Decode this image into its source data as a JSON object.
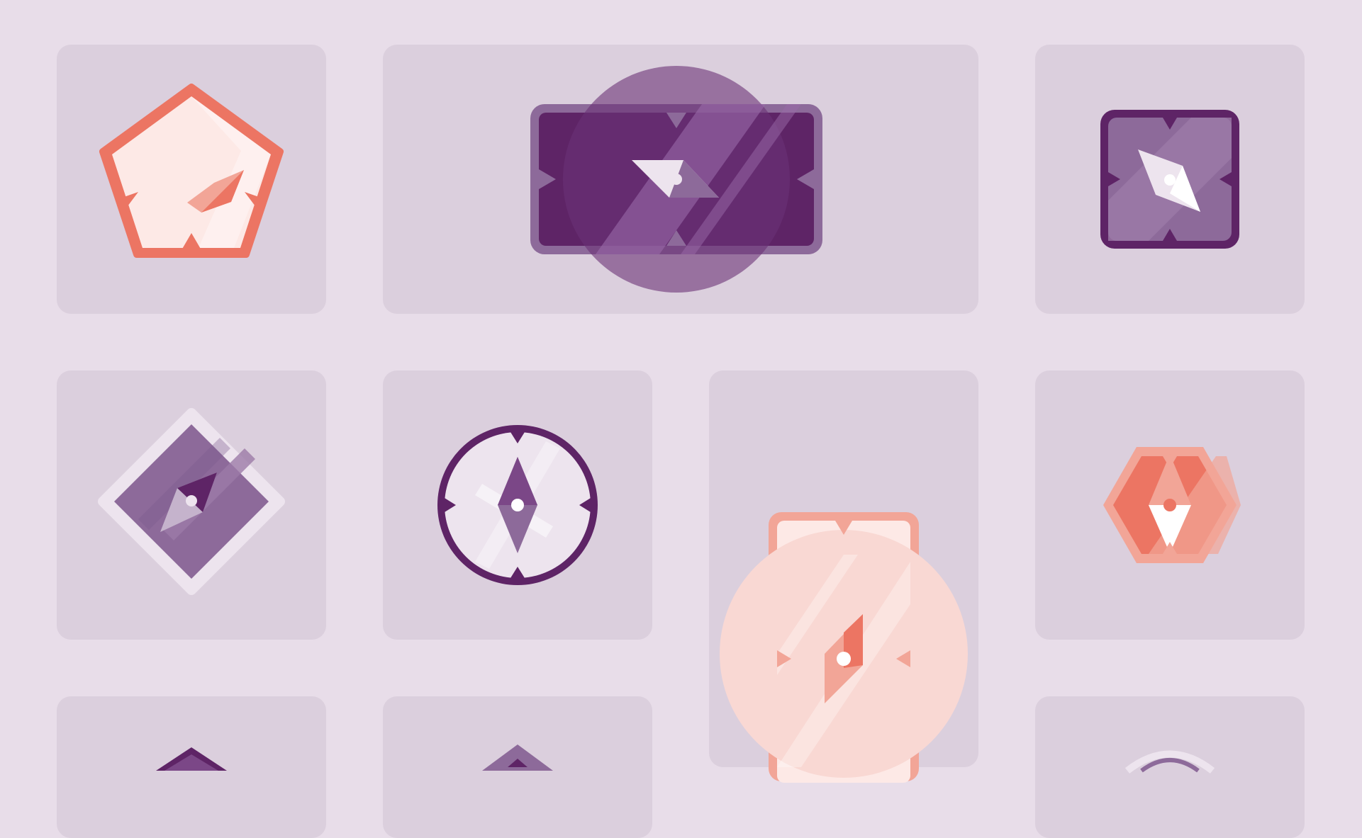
{
  "colors": {
    "page_background": "#e8dde9",
    "tile_background": "#dbcfdd",
    "coral": "#ec7563",
    "coral_light": "#f2a597",
    "blush": "#fde9e6",
    "plum_dark": "#5e2466",
    "plum": "#7b4787",
    "plum_mid": "#8d6a9a",
    "lavender_light": "#ede4ee",
    "white": "#ffffff"
  },
  "tiles": [
    {
      "id": "tile-r1c1",
      "badge": "pentagon-badge-coral"
    },
    {
      "id": "tile-r1c2-wide",
      "badge": "rectangle-badge-plum"
    },
    {
      "id": "tile-r1c4",
      "badge": "square-badge-plum"
    },
    {
      "id": "tile-r2c1",
      "badge": "diamond-badge-purple"
    },
    {
      "id": "tile-r2c2",
      "badge": "circle-badge-lavender"
    },
    {
      "id": "tile-r2c3-tall",
      "badge": "portrait-badge-peach"
    },
    {
      "id": "tile-r2c4",
      "badge": "hexagon-badge-coral"
    },
    {
      "id": "tile-r3c1",
      "badge": "badge-partial-plum"
    },
    {
      "id": "tile-r3c2",
      "badge": "badge-partial-purple"
    },
    {
      "id": "tile-r3c4",
      "badge": "badge-partial-lavender"
    }
  ]
}
